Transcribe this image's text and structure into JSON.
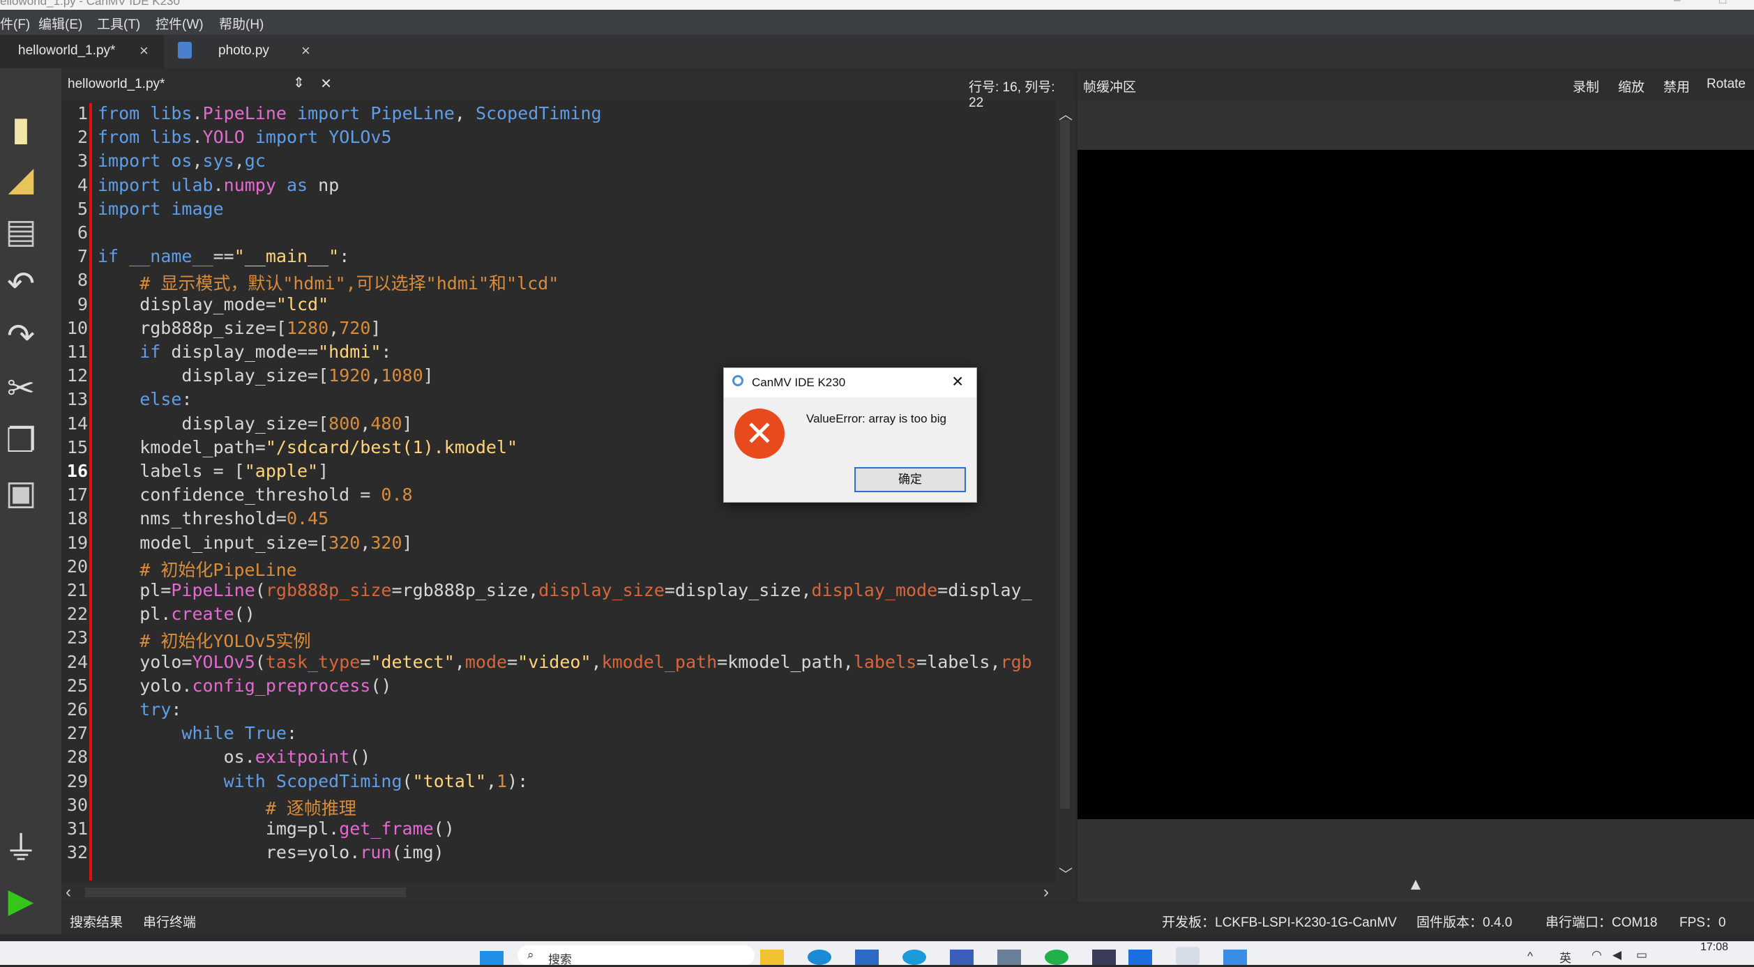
{
  "window": {
    "title": "elloworld_1.py - CanMV IDE K230"
  },
  "menu": [
    "件(F)",
    "编辑(E)",
    "工具(T)",
    "控件(W)",
    "帮助(H)"
  ],
  "tabs": [
    {
      "label": "helloworld_1.py*"
    },
    {
      "label": "photo.py"
    }
  ],
  "editor": {
    "file_label": "helloworld_1.py*",
    "cursor_pos": "行号: 16, 列号: 22",
    "lines": [
      {
        "n": "1",
        "html": "<span class='k'>from</span> <span class='k'>libs</span>.<span class='m'>PipeLine</span> <span class='k'>import</span> <span class='k'>PipeLine</span>, <span class='k'>ScopedTiming</span>"
      },
      {
        "n": "2",
        "html": "<span class='k'>from</span> <span class='k'>libs</span>.<span class='m'>YOLO</span> <span class='k'>import</span> <span class='k'>YOLOv5</span>"
      },
      {
        "n": "3",
        "html": "<span class='k'>import</span> <span class='k'>os</span>,<span class='k'>sys</span>,<span class='k'>gc</span>"
      },
      {
        "n": "4",
        "html": "<span class='k'>import</span> <span class='k'>ulab</span>.<span class='m'>numpy</span> <span class='k'>as</span> np"
      },
      {
        "n": "5",
        "html": "<span class='k'>import</span> <span class='k'>image</span>"
      },
      {
        "n": "6",
        "html": ""
      },
      {
        "n": "7",
        "html": "<span class='k'>if</span> <span class='k'>__name__</span>==<span class='s'>\"__main__\"</span>:"
      },
      {
        "n": "8",
        "html": "    <span class='c'># 显示模式，默认\"hdmi\",可以选择\"hdmi\"和\"lcd\"</span>"
      },
      {
        "n": "9",
        "html": "    display_mode=<span class='s'>\"lcd\"</span>"
      },
      {
        "n": "10",
        "html": "    rgb888p_size=[<span class='n'>1280</span>,<span class='n'>720</span>]"
      },
      {
        "n": "11",
        "html": "    <span class='k'>if</span> display_mode==<span class='s'>\"hdmi\"</span>:"
      },
      {
        "n": "12",
        "html": "        display_size=[<span class='n'>1920</span>,<span class='n'>1080</span>]"
      },
      {
        "n": "13",
        "html": "    <span class='k'>else</span>:"
      },
      {
        "n": "14",
        "html": "        display_size=[<span class='n'>800</span>,<span class='n'>480</span>]"
      },
      {
        "n": "15",
        "html": "    kmodel_path=<span class='s'>\"/sdcard/best(1).kmodel\"</span>"
      },
      {
        "n": "16",
        "html": "    labels = [<span class='s'>\"apple\"</span>]"
      },
      {
        "n": "17",
        "html": "    confidence_threshold = <span class='n'>0.8</span>"
      },
      {
        "n": "18",
        "html": "    nms_threshold=<span class='n'>0.45</span>"
      },
      {
        "n": "19",
        "html": "    model_input_size=[<span class='n'>320</span>,<span class='n'>320</span>]"
      },
      {
        "n": "20",
        "html": "    <span class='c'># 初始化PipeLine</span>"
      },
      {
        "n": "21",
        "html": "    pl=<span class='m'>PipeLine</span>(<span class='p'>rgb888p_size</span>=rgb888p_size,<span class='p'>display_size</span>=display_size,<span class='p'>display_mode</span>=display_"
      },
      {
        "n": "22",
        "html": "    pl.<span class='m'>create</span>()"
      },
      {
        "n": "23",
        "html": "    <span class='c'># 初始化YOLOv5实例</span>"
      },
      {
        "n": "24",
        "html": "    yolo=<span class='m'>YOLOv5</span>(<span class='p'>task_type</span>=<span class='s'>\"detect\"</span>,<span class='p'>mode</span>=<span class='s'>\"video\"</span>,<span class='p'>kmodel_path</span>=kmodel_path,<span class='p'>labels</span>=labels,<span class='p'>rgb</span>"
      },
      {
        "n": "25",
        "html": "    yolo.<span class='m'>config_preprocess</span>()"
      },
      {
        "n": "26",
        "html": "    <span class='k'>try</span>:"
      },
      {
        "n": "27",
        "html": "        <span class='k'>while</span> <span class='k'>True</span>:"
      },
      {
        "n": "28",
        "html": "            os.<span class='m'>exitpoint</span>()"
      },
      {
        "n": "29",
        "html": "            <span class='k'>with</span> <span class='k'>ScopedTiming</span>(<span class='s'>\"total\"</span>,<span class='n'>1</span>):"
      },
      {
        "n": "30",
        "html": "                <span class='c'># 逐帧推理</span>"
      },
      {
        "n": "31",
        "html": "                img=pl.<span class='m'>get_frame</span>()"
      },
      {
        "n": "32",
        "html": "                res=yolo.<span class='m'>run</span>(img)"
      }
    ]
  },
  "framebuffer": {
    "title": "帧缓冲区",
    "buttons": [
      "录制",
      "缩放",
      "禁用",
      "Rotate"
    ]
  },
  "bottom": {
    "tab1": "搜索结果",
    "tab2": "串行终端",
    "board": "开发板：LCKFB-LSPI-K230-1G-CanMV",
    "firmware": "固件版本：0.4.0",
    "port": "串行端口：COM18",
    "fps": "FPS：0"
  },
  "dialog": {
    "title": "CanMV IDE K230",
    "message": "ValueError: array is too big",
    "ok": "确定"
  },
  "taskbar": {
    "search": "搜索",
    "lang": "英",
    "time": "17:08"
  },
  "icons": {
    "new_file": "new-file-icon",
    "open": "open-folder-icon",
    "save": "save-icon",
    "undo": "undo-icon",
    "redo": "redo-icon",
    "cut": "cut-icon",
    "copy": "copy-icon",
    "paste": "paste-icon",
    "connect": "connect-icon",
    "run": "run-icon"
  },
  "colors": {
    "error_red": "#e8491d",
    "run_green": "#35c51b",
    "accent_blue": "#2a6fcf"
  }
}
